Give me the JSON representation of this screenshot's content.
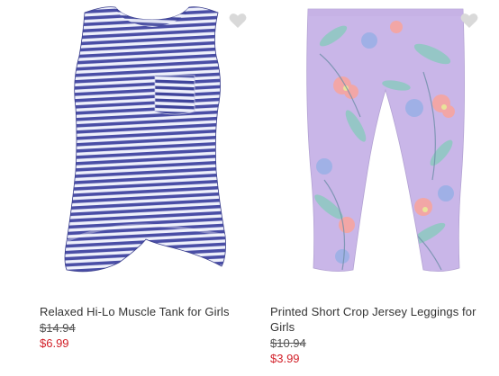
{
  "products": [
    {
      "name": "Relaxed Hi-Lo Muscle Tank for Girls",
      "original_price": "$14.94",
      "sale_price": "$6.99",
      "image_icon": "striped-tank-top-image"
    },
    {
      "name": "Printed Short Crop Jersey Leggings for Girls",
      "original_price": "$10.94",
      "sale_price": "$3.99",
      "image_icon": "floral-leggings-image"
    }
  ],
  "colors": {
    "sale_price": "#d21f28",
    "favorite_icon": "#d9d9d9",
    "tank_stripe": "#4a4ea6",
    "leggings_base": "#c9b6e8"
  }
}
